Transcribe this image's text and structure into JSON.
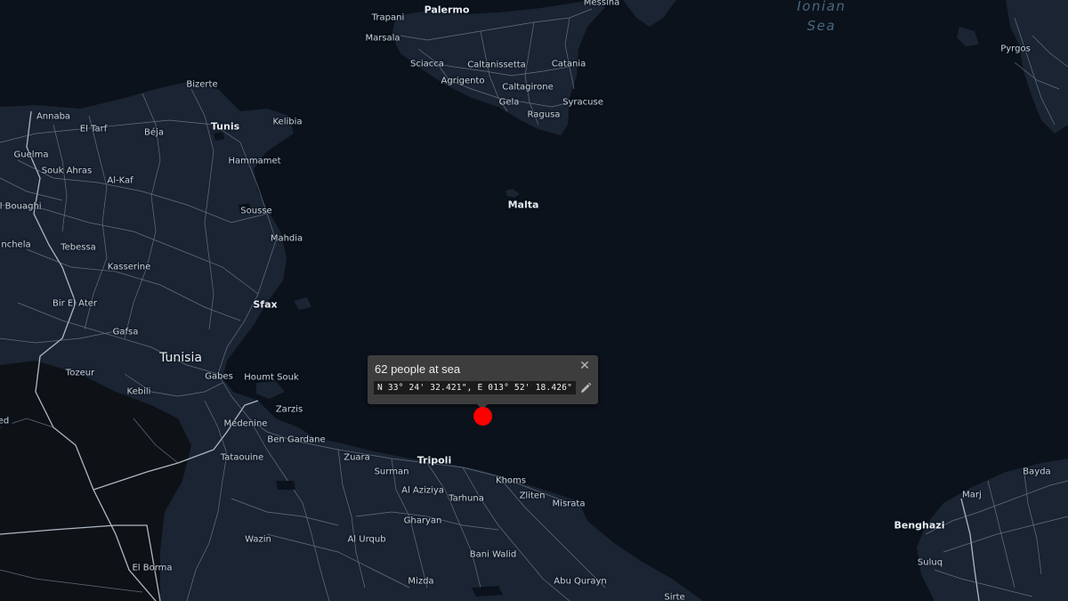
{
  "map": {
    "labels": {
      "ionian_sea": "Ionian",
      "ionian_sea_2": "Sea",
      "palermo": "Palermo",
      "messina": "Messina",
      "trapani": "Trapani",
      "marsala": "Marsala",
      "sciacca": "Sciacca",
      "caltanissetta": "Caltanissetta",
      "catania": "Catania",
      "agrigento": "Agrigento",
      "caltagirone": "Caltagirone",
      "gela": "Gela",
      "syracuse": "Syracuse",
      "ragusa": "Ragusa",
      "pyrgos": "Pyrgos",
      "malta": "Malta",
      "bizerte": "Bizerte",
      "annaba": "Annaba",
      "el_tarf": "El Tarf",
      "beja": "Béja",
      "tunis": "Tunis",
      "kelibia": "Kelibia",
      "guelma": "Guelma",
      "souk_ahras": "Souk Ahras",
      "hammamet": "Hammamet",
      "al_kaf": "Al-Kaf",
      "el_bouaghi": "El Bouaghi",
      "sousse": "Sousse",
      "mahdia": "Mahdia",
      "khenchela": "nchela",
      "tebessa": "Tebessa",
      "kasserine": "Kasserine",
      "bir_el_ater": "Bir El Ater",
      "sfax": "Sfax",
      "gafsa": "Gafsa",
      "tunisia": "Tunisia",
      "tozeur": "Tozeur",
      "gabes": "Gabes",
      "houmt_souk": "Houmt Souk",
      "kebili": "Kebili",
      "zarzis": "Zarzis",
      "ed": "ed",
      "medenine": "Medenine",
      "ben_gardane": "Ben Gardane",
      "tataouine": "Tataouine",
      "zuara": "Zuara",
      "tripoli": "Tripoli",
      "surman": "Surman",
      "khoms": "Khoms",
      "al_aziziya": "Al Aziziya",
      "tarhuna": "Tarhuna",
      "zliten": "Zliten",
      "misrata": "Misrata",
      "gharyan": "Gharyan",
      "wazin": "Wazin",
      "al_urqub": "Al Urqub",
      "bani_walid": "Bani Walid",
      "el_borma": "El Borma",
      "mizda": "Mizda",
      "abu_qurayn": "Abu Qurayn",
      "sirte": "Sirte",
      "bayda": "Bayda",
      "marj": "Marj",
      "benghazi": "Benghazi",
      "suluq": "Suluq"
    }
  },
  "popup": {
    "title": "62 people at sea",
    "coordinates": "N 33° 24' 32.421\", E 013° 52' 18.426\"",
    "close_icon": "close-icon",
    "edit_icon": "pencil-icon"
  },
  "marker": {
    "color": "#ff0000"
  },
  "colors": {
    "sea": "#0b121b",
    "land": "#1a2433",
    "borders": "#aeb7c2"
  }
}
